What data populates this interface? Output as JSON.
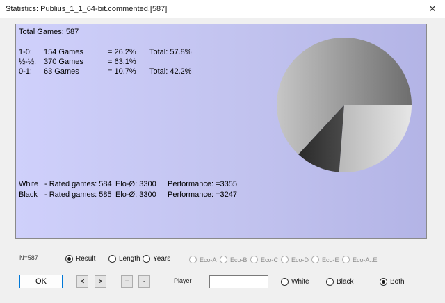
{
  "window": {
    "title": "Statistics: Publius_1_1_64-bit.commented.[587]"
  },
  "stats": {
    "total_games": "Total Games: 587",
    "results": [
      {
        "label": "1-0:",
        "games": "154 Games",
        "pct": "= 26.2%",
        "total": "Total: 57.8%"
      },
      {
        "label": "½-½:",
        "games": "370 Games",
        "pct": "= 63.1%",
        "total": ""
      },
      {
        "label": "0-1:",
        "games": "63 Games",
        "pct": "= 10.7%",
        "total": "Total: 42.2%"
      }
    ],
    "players": [
      {
        "side": "White",
        "rated": "- Rated games: 584",
        "elo": "Elo-Ø: 3300",
        "perf": "Performance: =3355"
      },
      {
        "side": "Black",
        "rated": "- Rated games: 585",
        "elo": "Elo-Ø: 3300",
        "perf": "Performance: =3247"
      }
    ]
  },
  "chart_data": {
    "type": "pie",
    "slices": [
      {
        "label": "1-0",
        "value": 26.2,
        "color": "#d4d4d4"
      },
      {
        "label": "0-1",
        "value": 10.7,
        "color": "#333333"
      },
      {
        "label": "½-½",
        "value": 63.1,
        "color": "#a8a8a8"
      }
    ]
  },
  "footer": {
    "n_label": "N=587",
    "mode_options": [
      {
        "label": "Result",
        "checked": true
      },
      {
        "label": "Length",
        "checked": false
      },
      {
        "label": "Years",
        "checked": false
      }
    ],
    "eco_options": [
      "Eco-A",
      "Eco-B",
      "Eco-C",
      "Eco-D",
      "Eco-E",
      "Eco-A..E"
    ],
    "buttons": {
      "ok": "OK",
      "prev": "<",
      "next": ">",
      "plus": "+",
      "minus": "-"
    },
    "player_label": "Player",
    "player_value": "",
    "color_options": [
      {
        "label": "White",
        "checked": false
      },
      {
        "label": "Black",
        "checked": false
      },
      {
        "label": "Both",
        "checked": true
      }
    ]
  }
}
